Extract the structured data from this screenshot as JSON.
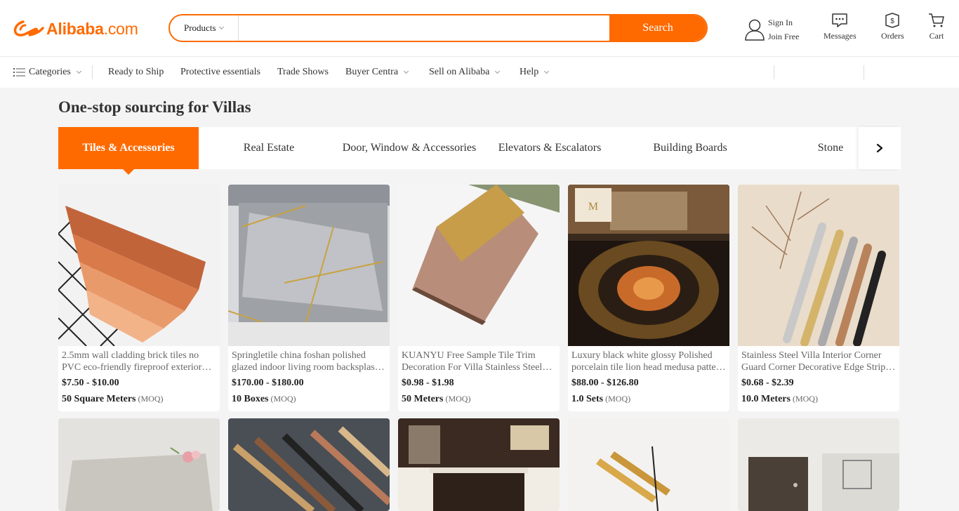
{
  "header": {
    "logo_text": "Alibaba",
    "logo_suffix": ".com",
    "search": {
      "category": "Products",
      "placeholder": "",
      "button": "Search"
    },
    "user": {
      "sign_in": "Sign In",
      "join": "Join Free"
    },
    "messages": "Messages",
    "orders": "Orders",
    "cart": "Cart"
  },
  "nav": {
    "categories": "Categories",
    "links": [
      "Ready to Ship",
      "Protective essentials",
      "Trade Shows",
      "Buyer Centra",
      "Sell on Alibaba",
      "Help"
    ]
  },
  "page": {
    "title": "One-stop sourcing for Villas",
    "tabs": [
      "Tiles & Accessories",
      "Real Estate",
      "Door, Window & Accessories",
      "Elevators & Escalators",
      "Building Boards",
      "Stone"
    ],
    "active_tab": "Tiles & Accessories"
  },
  "products": [
    {
      "line1": "2.5mm wall cladding brick tiles no",
      "line2": "PVC eco-friendly fireproof exterior…",
      "price": "$7.50 - $10.00",
      "moq": "50 Square Meters",
      "moq_tag": "(MOQ)"
    },
    {
      "line1": "Springletile china foshan polished",
      "line2": "glazed indoor living room backsplas…",
      "price": "$170.00 - $180.00",
      "moq": "10 Boxes",
      "moq_tag": "(MOQ)"
    },
    {
      "line1": "KUANYU Free Sample Tile Trim",
      "line2": "Decoration For Villa Stainless Steel…",
      "price": "$0.98 - $1.98",
      "moq": "50 Meters",
      "moq_tag": "(MOQ)"
    },
    {
      "line1": "Luxury black white glossy Polished",
      "line2": "porcelain tile lion head medusa patte…",
      "price": "$88.00 - $126.80",
      "moq": "1.0 Sets",
      "moq_tag": "(MOQ)"
    },
    {
      "line1": "Stainless Steel Villa Interior Corner",
      "line2": "Guard Corner Decorative Edge Strip…",
      "price": "$0.68 - $2.39",
      "moq": "10.0 Meters",
      "moq_tag": "(MOQ)"
    }
  ],
  "colors": {
    "brand": "#ff6a00",
    "background": "#f4f4f4"
  }
}
